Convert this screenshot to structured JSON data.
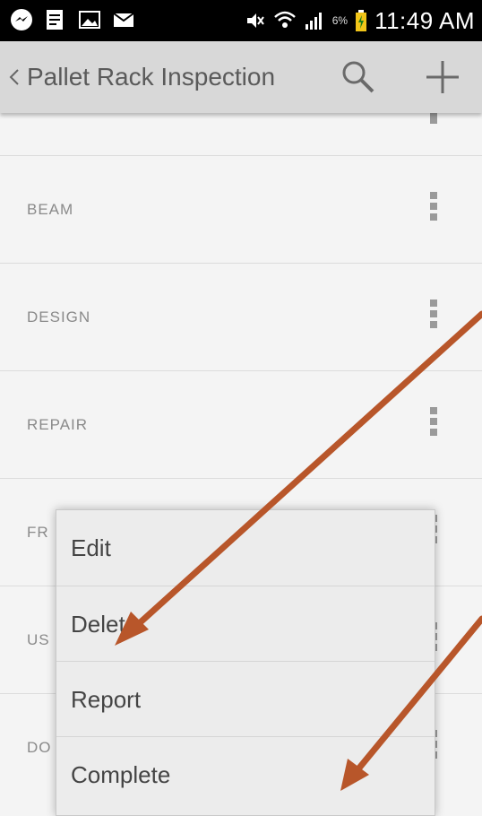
{
  "status_bar": {
    "battery_percent": "6%",
    "time": "11:49 AM"
  },
  "action_bar": {
    "title": "Pallet Rack Inspection",
    "back_icon": "chevron-left-icon",
    "search_icon": "search-icon",
    "add_icon": "plus-icon"
  },
  "list": {
    "items": [
      {
        "label": "BEAM"
      },
      {
        "label": "DESIGN"
      },
      {
        "label": "REPAIR"
      },
      {
        "label": "FR"
      },
      {
        "label": "US"
      },
      {
        "label": "DO"
      }
    ]
  },
  "popup_menu": {
    "items": [
      {
        "label": "Edit"
      },
      {
        "label": "Delete"
      },
      {
        "label": "Report"
      },
      {
        "label": "Complete"
      }
    ]
  },
  "colors": {
    "arrow": "#b8562a",
    "action_bar_bg": "#d8d8d8",
    "list_bg": "#f4f4f4"
  }
}
